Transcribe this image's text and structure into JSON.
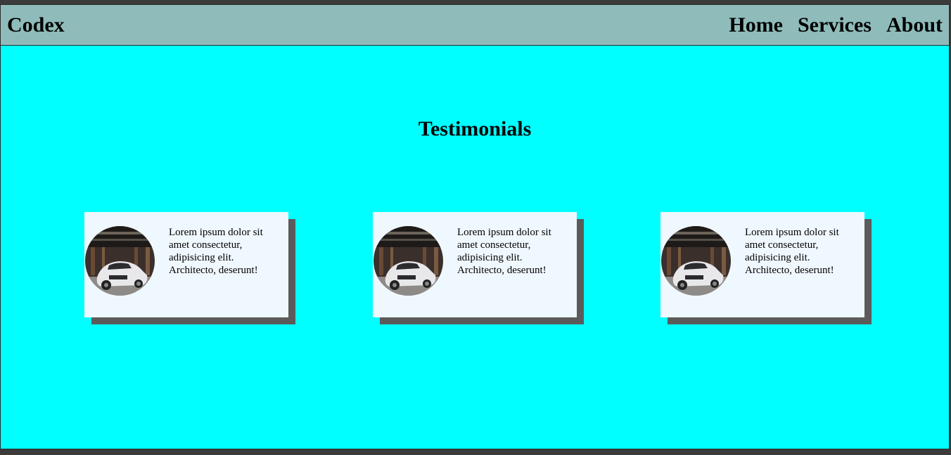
{
  "navbar": {
    "brand": "Codex",
    "links": [
      "Home",
      "Services",
      "About"
    ]
  },
  "section": {
    "title": "Testimonials"
  },
  "testimonials": [
    {
      "text": "Lorem ipsum dolor sit amet consectetur, adipisicing elit. Architecto, deserunt!",
      "image": "car-photo"
    },
    {
      "text": "Lorem ipsum dolor sit amet consectetur, adipisicing elit. Architecto, deserunt!",
      "image": "car-photo"
    },
    {
      "text": "Lorem ipsum dolor sit amet consectetur, adipisicing elit. Architecto, deserunt!",
      "image": "car-photo"
    }
  ],
  "colors": {
    "page_background": "#00ffff",
    "navbar_background": "#8fbcbb",
    "card_background": "#f0f8ff",
    "card_shadow": "#5b5b5b"
  }
}
